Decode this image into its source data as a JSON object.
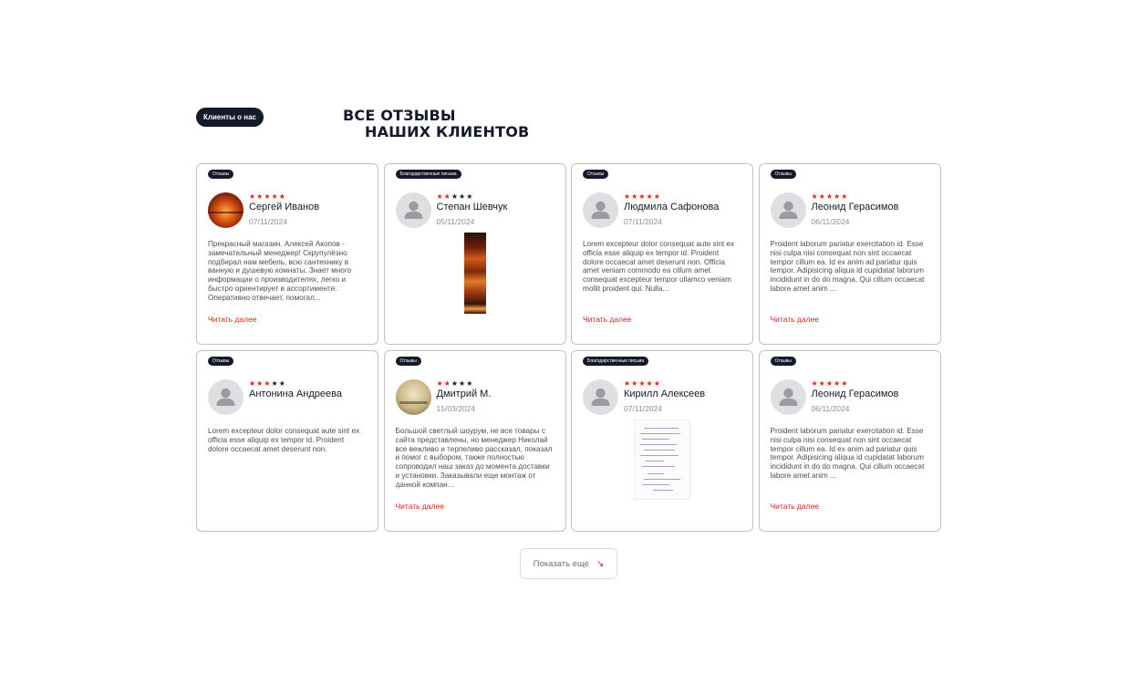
{
  "section": {
    "pill": "Клиенты о нас",
    "title_line1": "ВСЕ ОТЗЫВЫ",
    "title_line2": "НАШИХ КЛИЕНТОВ"
  },
  "cards": [
    {
      "tag": "Отзывы",
      "rating": 5,
      "name": "Сергей Иванов",
      "date": "07/11/2024",
      "avatar": "photo-sunset",
      "text": "Прекрасный магазин. Алексей Акопов - замечательный менеджер! Скрупулёзно подбирал нам мебель, всю сантехнику в ванную и душевую комнаты. Знает много информации о производителях, легко и быстро ориентирует в ассортименте. Оперативно отвечает, помогал...",
      "read_more": "Читать далее"
    },
    {
      "tag": "Благодарственные письма",
      "rating": 2,
      "name": "Степан Шевчук",
      "date": "05/11/2024",
      "avatar": "placeholder-user",
      "media": "sunset-strip"
    },
    {
      "tag": "Отзывы",
      "rating": 5,
      "name": "Людмила Сафонова",
      "date": "07/11/2024",
      "avatar": "placeholder-user",
      "text": "Lorem excepteur dolor consequat aute sint ex officia esse aliquip ex tempor id. Proident dolore occaecat amet deserunt non. Officia amet veniam commodo ea cillum amet consequat excepteur tempor ullamco veniam mollit proident qui. Nulla...",
      "read_more": "Читать далее"
    },
    {
      "tag": "Отзывы",
      "rating": 5,
      "name": "Леонид Герасимов",
      "date": "06/11/2024",
      "avatar": "placeholder-user",
      "text": "Proident laborum pariatur exercitation id. Esse nisi culpa nisi consequat non sint occaecat tempor cillum ea. Id ex anim ad pariatur quis tempor. Adipisicing aliqua id cupidatat laborum incididunt in do do magna. Qui cillum occaecat labore amet anim ...",
      "read_more": "Читать далее"
    },
    {
      "tag": "Отзывы",
      "rating": 3,
      "name": "Антонина Андреева",
      "date": "",
      "avatar": "placeholder-user",
      "text": "Lorem excepteur dolor consequat aute sint ex officia esse aliquip ex tempor id. Proident dolore occaecat amet deserunt non."
    },
    {
      "tag": "Отзывы",
      "rating": 2,
      "name": "Дмитрий М.",
      "date": "15/03/2024",
      "avatar": "photo-sand",
      "text": "Большой светлый шоурум, не все товары с сайта представлены, но менеджер Николай все вежливо и терпеливо рассказал, показал и помог с выбором, также полностью сопроводил наш заказ до момента доставки и установки. Заказывали еще монтаж от данной компан...",
      "read_more": "Читать далее"
    },
    {
      "tag": "Благодарственные письма",
      "rating": 5,
      "name": "Кирилл Алексеев",
      "date": "07/11/2024",
      "avatar": "placeholder-user",
      "media": "handwritten-letter"
    },
    {
      "tag": "Отзывы",
      "rating": 5,
      "name": "Леонид Герасимов",
      "date": "06/11/2024",
      "avatar": "placeholder-user",
      "text": "Proident laborum pariatur exercitation id. Esse nisi culpa nisi consequat non sint occaecat tempor cillum ea. Id ex anim ad pariatur quis tempor. Adipisicing aliqua id cupidatat laborum incididunt in do do magna. Qui cillum occaecat labore amet anim ...",
      "read_more": "Читать далее"
    }
  ],
  "show_more": {
    "label": "Показать еще",
    "icon": "arrow-down-right-icon"
  },
  "colors": {
    "accent": "#d4251c",
    "dark": "#141a29",
    "border": "#bfc3c9"
  }
}
